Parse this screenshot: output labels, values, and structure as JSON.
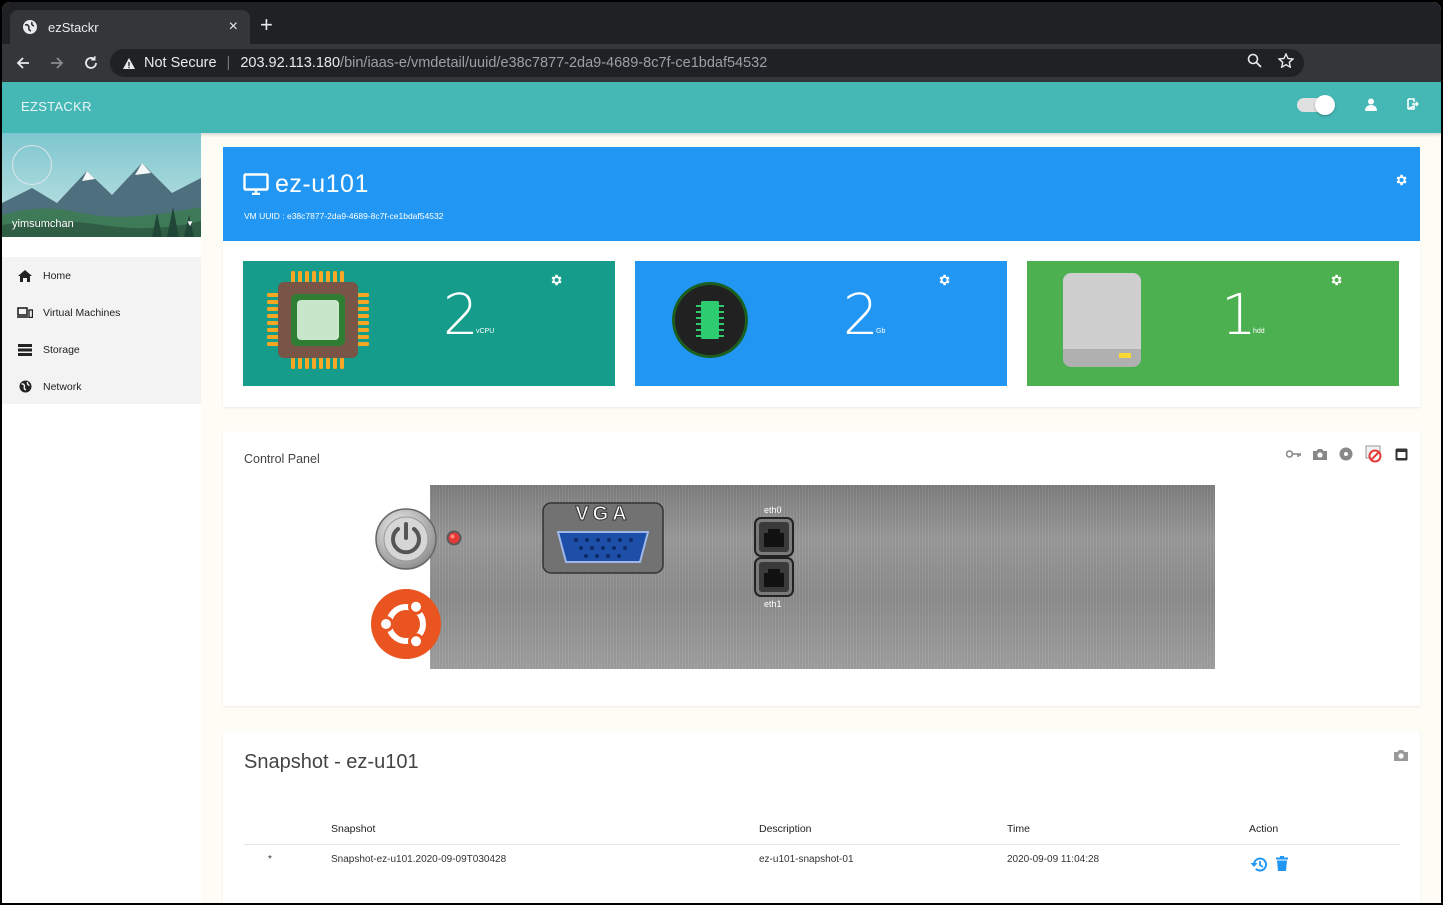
{
  "browser": {
    "tab_title": "ezStackr",
    "tab_close": "×",
    "new_tab": "+",
    "security_label": "Not Secure",
    "url_host": "203.92.113.180",
    "url_path": "/bin/iaas-e/vmdetail/uuid/e38c7877-2da9-4689-8c7f-ce1bdaf54532"
  },
  "app": {
    "brand": "EZSTACKR"
  },
  "sidebar": {
    "username": "yimsumchan",
    "items": [
      {
        "label": "Home",
        "icon": "home-icon"
      },
      {
        "label": "Virtual Machines",
        "icon": "virtual-machines-icon"
      },
      {
        "label": "Storage",
        "icon": "storage-icon"
      },
      {
        "label": "Network",
        "icon": "globe-icon"
      }
    ]
  },
  "vm": {
    "name": "ez-u101",
    "uuid_label": "VM UUID : e38c7877-2da9-4689-8c7f-ce1bdaf54532"
  },
  "resources": {
    "cpu": {
      "value": "2",
      "unit": "vCPU",
      "color": "#169c8a"
    },
    "memory": {
      "value": "2",
      "unit": "Gb",
      "color": "#2196f3"
    },
    "disk": {
      "value": "1",
      "unit": "hdd",
      "color": "#4caf50"
    }
  },
  "control_panel": {
    "title": "Control Panel",
    "vga_label": "VGA",
    "eth0_label": "eth0",
    "eth1_label": "eth1",
    "power_led_color": "#e53935"
  },
  "snapshot": {
    "title": "Snapshot - ez-u101",
    "columns": {
      "snapshot": "Snapshot",
      "description": "Description",
      "time": "Time",
      "action": "Action"
    },
    "rows": [
      {
        "marker": "*",
        "name": "Snapshot-ez-u101.2020-09-09T030428",
        "description": "ez-u101-snapshot-01",
        "time": "2020-09-09 11:04:28"
      }
    ]
  },
  "colors": {
    "appbar": "#45b7b5",
    "vm_header": "#2196f3",
    "action_blue": "#2196f3"
  }
}
